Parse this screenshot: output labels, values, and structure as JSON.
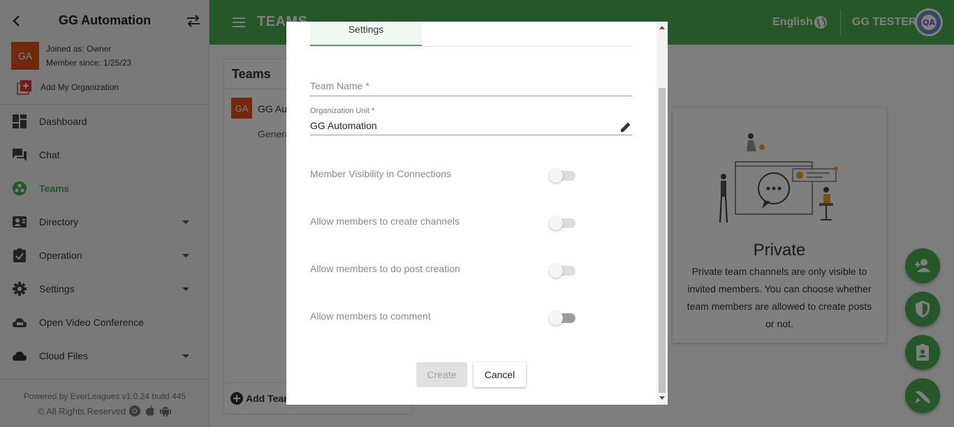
{
  "sidebar": {
    "org_title": "GG Automation",
    "org_avatar": "GA",
    "joined_as": "Joined as: Owner",
    "member_since": "Member since: 1/25/23",
    "add_org": "Add My Organization",
    "items": [
      {
        "label": "Dashboard",
        "icon": "dashboard-icon"
      },
      {
        "label": "Chat",
        "icon": "chat-icon"
      },
      {
        "label": "Teams",
        "icon": "teams-icon",
        "active": true
      },
      {
        "label": "Directory",
        "icon": "contact-card-icon",
        "dropdown": true
      },
      {
        "label": "Operation",
        "icon": "clipboard-check-icon",
        "dropdown": true
      },
      {
        "label": "Settings",
        "icon": "gear-icon",
        "dropdown": true
      },
      {
        "label": "Open Video Conference",
        "icon": "video-cloud-icon"
      },
      {
        "label": "Cloud Files",
        "icon": "cloud-icon",
        "dropdown": true
      }
    ],
    "powered_by": "Powered by EverLeagues v1.0.24 build 445",
    "rights": "© All Rights Reserved"
  },
  "header": {
    "title": "TEAMS",
    "language": "English",
    "user_name": "GG TESTER",
    "user_avatar": "QA"
  },
  "teams_panel": {
    "title": "Teams",
    "team_avatar": "GA",
    "team_name": "GG Aut",
    "team_sub": "Genera",
    "add_team": "Add Team"
  },
  "private_card": {
    "title": "Private",
    "description": "Private team channels are only visible to invited members. You can choose whether team members are allowed to create posts or not."
  },
  "modal": {
    "tab_settings": "Settings",
    "team_name_placeholder": "Team Name *",
    "org_unit_label": "Organization Unit *",
    "org_unit_value": "GG Automation",
    "toggles": [
      {
        "label": "Member Visibility in Connections",
        "on": false
      },
      {
        "label": "Allow members to create channels",
        "on": false
      },
      {
        "label": "Allow members to do post creation",
        "on": false
      },
      {
        "label": "Allow members to comment",
        "on": false
      }
    ],
    "create_label": "Create",
    "cancel_label": "Cancel"
  },
  "colors": {
    "brand_green": "#4caf50",
    "avatar_orange": "#e0521e"
  }
}
